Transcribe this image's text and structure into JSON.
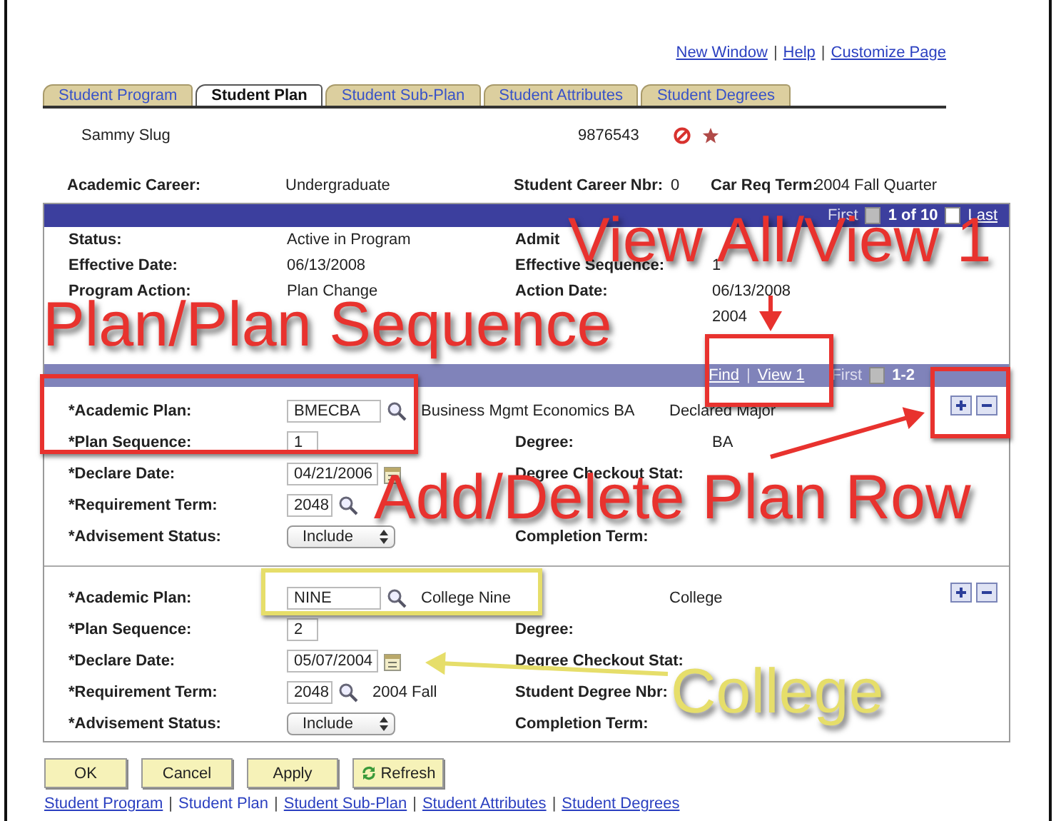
{
  "header_links": {
    "items": [
      "New Window",
      "Help",
      "Customize Page"
    ],
    "separator": "|"
  },
  "tabs": [
    {
      "label": "Student Program",
      "selected": false
    },
    {
      "label": "Student Plan",
      "selected": true
    },
    {
      "label": "Student Sub-Plan",
      "selected": false
    },
    {
      "label": "Student Attributes",
      "selected": false
    },
    {
      "label": "Student Degrees",
      "selected": false
    }
  ],
  "student": {
    "name": "Sammy Slug",
    "id": "9876543"
  },
  "career": [
    {
      "label": "Academic Career:",
      "value": "Undergraduate"
    },
    {
      "label": "Student Career Nbr:",
      "value": "0"
    },
    {
      "label": "Car Req Term:",
      "value": "2004 Fall Quarter"
    }
  ],
  "program": {
    "nav": [
      {
        "kind": "text",
        "text": "First"
      },
      {
        "kind": "prev",
        "disabled": true
      },
      {
        "kind": "count",
        "text": "1 of 10"
      },
      {
        "kind": "next",
        "disabled": false
      },
      {
        "kind": "link",
        "text": "Last"
      }
    ],
    "fields": [
      {
        "label": "Status:",
        "value": "Active in Program",
        "label_2": "Admit"
      },
      {
        "label": "Effective Date:",
        "value": "06/13/2008",
        "label_2": "Effective Sequence:",
        "value_2": "1"
      },
      {
        "label": "Program Action:",
        "value": "Plan Change",
        "label_2": "Action Date:",
        "value_2": "06/13/2008"
      },
      {
        "value_2": "2004"
      }
    ]
  },
  "plans": {
    "nav": [
      {
        "kind": "link",
        "text": "Find"
      },
      {
        "kind": "sep",
        "text": "|"
      },
      {
        "kind": "link",
        "text": "View 1"
      },
      {
        "kind": "text",
        "text": "First"
      },
      {
        "kind": "prev",
        "disabled": true
      },
      {
        "kind": "count",
        "text": "1-2"
      }
    ],
    "rows": [
      {
        "fields": [
          {
            "label": "*Academic Plan:",
            "kind": "lookup",
            "value": "BMECBA",
            "description": "Business Mgmt Economics BA",
            "status": "Declared Major"
          },
          {
            "label": "*Plan Sequence:",
            "kind": "input",
            "value": "1",
            "label_2": "Degree:",
            "value_2": "BA"
          },
          {
            "label": "*Declare Date:",
            "kind": "date",
            "value": "04/21/2006",
            "label_2": "Degree Checkout Stat:"
          },
          {
            "label": "*Requirement Term:",
            "kind": "lookup",
            "value": "2048"
          },
          {
            "label": "*Advisement Status:",
            "kind": "select",
            "value": "Include",
            "label_2": "Completion Term:"
          }
        ]
      },
      {
        "fields": [
          {
            "label": "*Academic Plan:",
            "kind": "lookup",
            "value": "NINE",
            "description": "College Nine",
            "status": "College"
          },
          {
            "label": "*Plan Sequence:",
            "kind": "input",
            "value": "2",
            "label_2": "Degree:"
          },
          {
            "label": "*Declare Date:",
            "kind": "date",
            "value": "05/07/2004",
            "label_2": "Degree Checkout Stat:"
          },
          {
            "label": "*Requirement Term:",
            "kind": "lookup",
            "value": "2048",
            "description": "2004 Fall",
            "label_2": "Student Degree Nbr:"
          },
          {
            "label": "*Advisement Status:",
            "kind": "select",
            "value": "Include",
            "label_2": "Completion Term:"
          }
        ]
      }
    ]
  },
  "buttons": [
    {
      "label": "OK",
      "kind": "plain"
    },
    {
      "label": "Cancel",
      "kind": "plain"
    },
    {
      "label": "Apply",
      "kind": "plain"
    },
    {
      "label": "Refresh",
      "kind": "refresh"
    }
  ],
  "footer_links": {
    "items": [
      {
        "text": "Student Program",
        "selected": false
      },
      {
        "text": "Student Plan",
        "selected": true
      },
      {
        "text": "Student Sub-Plan",
        "selected": false
      },
      {
        "text": "Student Attributes",
        "selected": false
      },
      {
        "text": "Student Degrees",
        "selected": false
      }
    ],
    "separator": "|"
  },
  "annotations": [
    {
      "text": "View All/View 1",
      "color": "#e8322e"
    },
    {
      "text": "Plan/Plan Sequence",
      "color": "#e8322e"
    },
    {
      "text": "Add/Delete Plan Row",
      "color": "#e8322e"
    },
    {
      "text": "College",
      "color": "#e6de6a"
    }
  ]
}
